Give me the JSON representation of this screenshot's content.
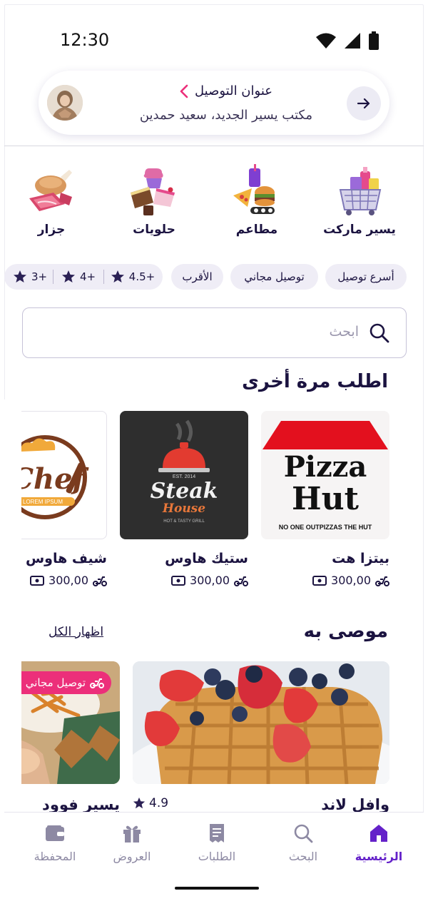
{
  "status_bar": {
    "time": "12:30"
  },
  "address": {
    "title": "عنوان التوصيل",
    "subtitle": "مكتب يسير الجديد، سعيد حمدين"
  },
  "categories": [
    {
      "label": "يسير ماركت",
      "icon": "market-icon"
    },
    {
      "label": "مطاعم",
      "icon": "restaurant-food-icon"
    },
    {
      "label": "حلويات",
      "icon": "sweets-icon"
    },
    {
      "label": "جزار",
      "icon": "butcher-meat-icon"
    }
  ],
  "filters": {
    "fastest": "أسرع توصيل",
    "free_delivery": "توصيل مجاني",
    "nearest": "الأقرب",
    "ratings": [
      "4.5+",
      "4+",
      "3+"
    ]
  },
  "search": {
    "placeholder": "ابحث"
  },
  "order_again": {
    "title": "اطلب مرة أخرى",
    "items": [
      {
        "name": "بيتزا هت",
        "fee": "300,00",
        "logo_text": [
          "Pizza",
          "Hut",
          "NO ONE OUTPIZZAS THE HUT"
        ]
      },
      {
        "name": "ستيك هاوس",
        "fee": "300,00",
        "logo_text": [
          "EST. 2014",
          "Steak",
          "House",
          "HOT & TASTY GRILL"
        ]
      },
      {
        "name": "شيف هاوس",
        "fee": "300,00",
        "logo_text": [
          "Chef",
          "LOREM IPSUM"
        ]
      }
    ]
  },
  "recommended": {
    "title": "موصى به",
    "show_all": "اظهار الكل",
    "items": [
      {
        "name": "وافل لاند",
        "rating": "4.9"
      },
      {
        "name": "يسير فوود",
        "badge": "توصيل مجاني"
      }
    ]
  },
  "bottom_nav": [
    {
      "label": "الرئيسية",
      "icon": "home-icon",
      "active": true
    },
    {
      "label": "البحث",
      "icon": "search-icon",
      "active": false
    },
    {
      "label": "الطلبات",
      "icon": "receipt-icon",
      "active": false
    },
    {
      "label": "العروض",
      "icon": "gift-icon",
      "active": false
    },
    {
      "label": "المحفظة",
      "icon": "wallet-icon",
      "active": false
    }
  ],
  "colors": {
    "primary": "#6421c9",
    "accent_pink": "#ec2f7a",
    "text_dark": "#1b1340",
    "chip_bg": "#efedf6"
  }
}
